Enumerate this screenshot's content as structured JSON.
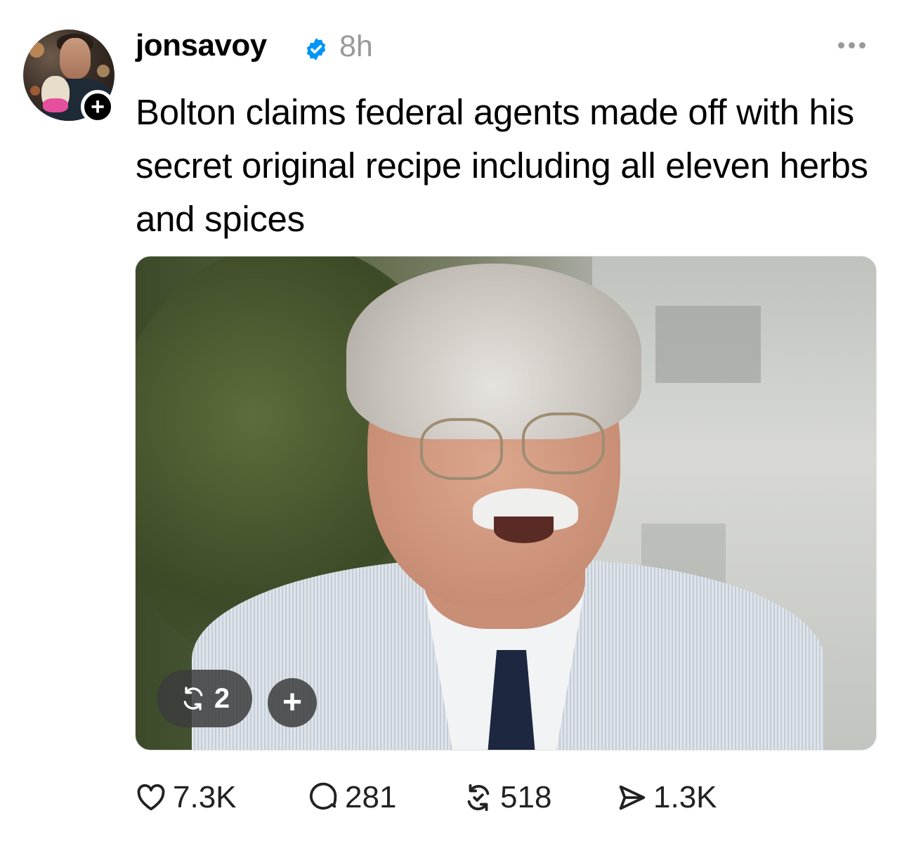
{
  "post": {
    "username": "jonsavoy",
    "timestamp": "8h",
    "text": "Bolton claims federal agents made off with his secret original recipe including all eleven herbs and spices",
    "follow_symbol": "+",
    "media": {
      "repost_count": "2",
      "add_symbol": "+"
    },
    "actions": {
      "likes": "7.3K",
      "replies": "281",
      "reposts": "518",
      "shares": "1.3K"
    }
  },
  "colors": {
    "verified": "#0095F6",
    "muted": "#999999",
    "text": "#000000"
  },
  "icons": [
    "verified-icon",
    "more-icon",
    "heart-icon",
    "comment-icon",
    "repost-icon",
    "share-icon"
  ]
}
